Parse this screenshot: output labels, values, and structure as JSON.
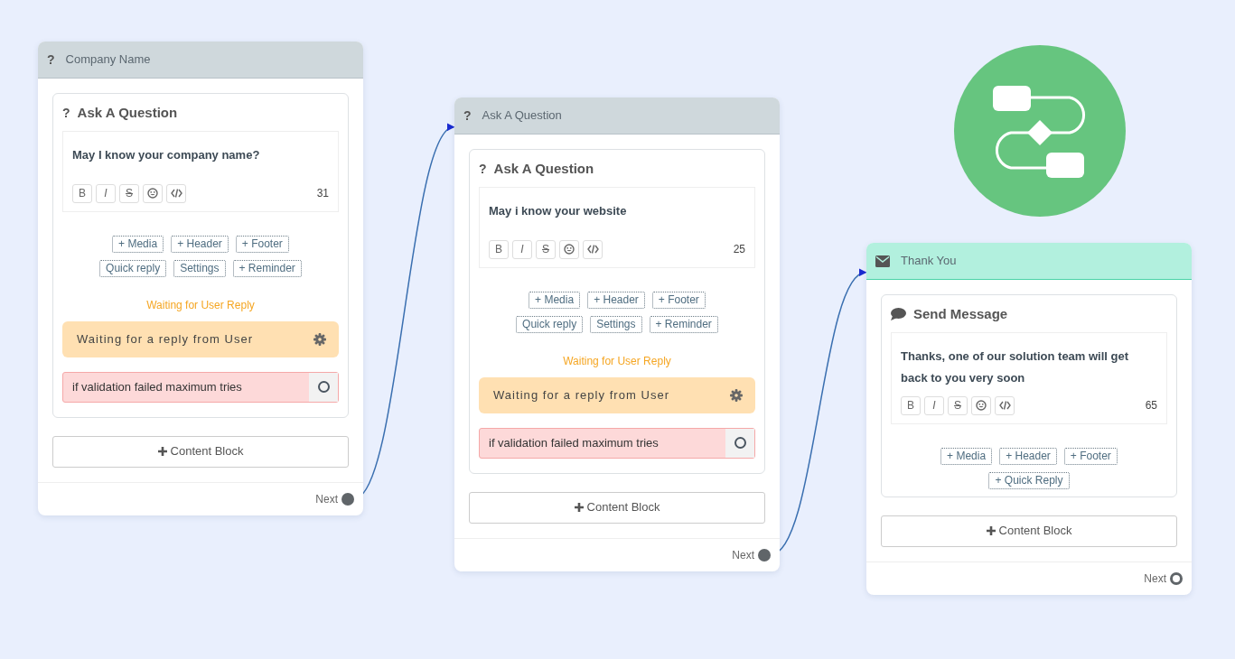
{
  "nodes": [
    {
      "kind": "question",
      "color": "#cfd8dc",
      "title": "Company Name",
      "glyph": "?",
      "block": {
        "title": "Ask A Question",
        "glyph": "?",
        "text": "May I know your company name?",
        "count": "31"
      },
      "toolbar": [
        {
          "kind": "bold",
          "label": "B"
        },
        {
          "kind": "italic",
          "label": "I"
        },
        {
          "kind": "strike",
          "label": "S"
        },
        {
          "kind": "emoji"
        },
        {
          "kind": "code"
        }
      ],
      "add_buttons": [
        [
          "+ Media",
          "+ Header",
          "+ Footer"
        ],
        [
          "Quick reply",
          "Settings",
          "+ Reminder"
        ]
      ],
      "waiting_label": "Waiting for User Reply",
      "waiting_text": "Waiting for a reply from User",
      "validation_text": "if validation failed maximum tries",
      "content_button": "Content Block",
      "next_label": "Next",
      "connected": true
    },
    {
      "kind": "question",
      "color": "#cfd8dc",
      "title": "Ask A Question",
      "glyph": "?",
      "block": {
        "title": "Ask A Question",
        "glyph": "?",
        "text": "May i know your website",
        "count": "25"
      },
      "toolbar": [
        {
          "kind": "bold",
          "label": "B"
        },
        {
          "kind": "italic",
          "label": "I"
        },
        {
          "kind": "strike",
          "label": "S"
        },
        {
          "kind": "emoji"
        },
        {
          "kind": "code"
        }
      ],
      "add_buttons": [
        [
          "+ Media",
          "+ Header",
          "+ Footer"
        ],
        [
          "Quick reply",
          "Settings",
          "+ Reminder"
        ]
      ],
      "waiting_label": "Waiting for User Reply",
      "waiting_text": "Waiting for a reply from User",
      "validation_text": "if validation failed maximum tries",
      "content_button": "Content Block",
      "next_label": "Next",
      "connected": true
    },
    {
      "kind": "message",
      "color": "#b2f0de",
      "title": "Thank You",
      "block": {
        "title": "Send Message",
        "text": "Thanks, one of our solution team will get back to you very soon",
        "count": "65"
      },
      "toolbar": [
        {
          "kind": "bold",
          "label": "B"
        },
        {
          "kind": "italic",
          "label": "I"
        },
        {
          "kind": "strike",
          "label": "S"
        },
        {
          "kind": "emoji"
        },
        {
          "kind": "code"
        }
      ],
      "add_buttons": [
        [
          "+ Media",
          "+ Header",
          "+ Footer"
        ],
        [
          "+ Quick Reply"
        ]
      ],
      "content_button": "Content Block",
      "next_label": "Next",
      "connected": false
    }
  ]
}
